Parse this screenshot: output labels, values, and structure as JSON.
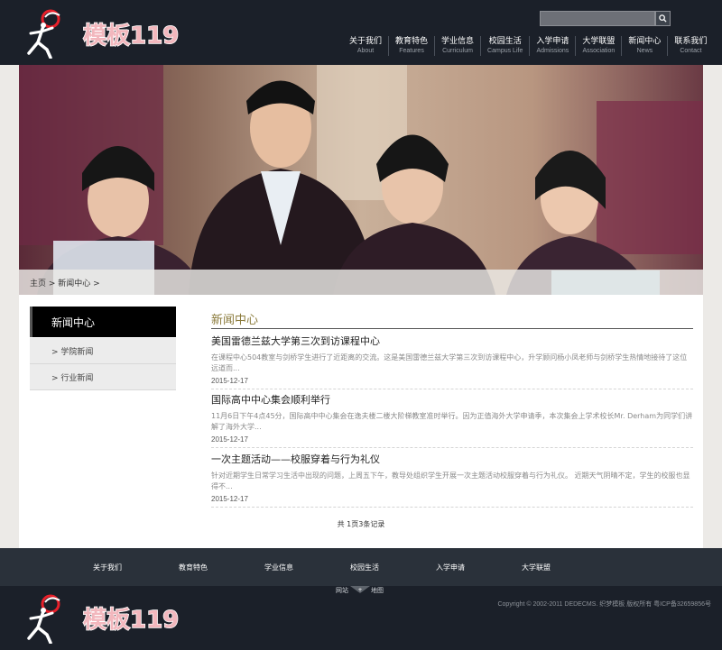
{
  "brand": {
    "logo_text": "模板119",
    "accent_color": "#e8202a",
    "logo_text_color": "#f2b7bd"
  },
  "search": {
    "placeholder": "",
    "button_icon": "search-icon"
  },
  "nav": [
    {
      "zh": "关于我们",
      "en": "About"
    },
    {
      "zh": "教育特色",
      "en": "Features"
    },
    {
      "zh": "学业信息",
      "en": "Curriculum"
    },
    {
      "zh": "校园生活",
      "en": "Campus Life"
    },
    {
      "zh": "入学申请",
      "en": "Admissions"
    },
    {
      "zh": "大学联盟",
      "en": "Association"
    },
    {
      "zh": "新闻中心",
      "en": "News"
    },
    {
      "zh": "联系我们",
      "en": "Contact"
    }
  ],
  "breadcrumb": "主页 > 新闻中心 >",
  "sidebar": {
    "title": "新闻中心",
    "items": [
      "> 学院新闻",
      "> 行业新闻"
    ]
  },
  "section_title": "新闻中心",
  "articles": [
    {
      "title": "美国雷德兰兹大学第三次到访课程中心",
      "summary": "在课程中心504教室与剑桥学生进行了近距离的交流。这是美国雷德兰兹大学第三次到访课程中心，升学顾问杨小凤老师与剑桥学生热情地接待了这位远道而...",
      "date": "2015-12-17"
    },
    {
      "title": "国际高中中心集会顺利举行",
      "summary": "11月6日下午4点45分，国际高中中心集会在逸夫楼二楼大阶梯教室准时举行。因为正值海外大学申请季，本次集会上学术校长Mr. Derham为同学们讲解了海外大学...",
      "date": "2015-12-17"
    },
    {
      "title": "一次主题活动——校服穿着与行为礼仪",
      "summary": "针对近期学生日常学习生活中出现的问题，上周五下午，教导处组织学生开展一次主题活动校服穿着与行为礼仪。 近期天气阴晴不定，学生的校服也显得不...",
      "date": "2015-12-17"
    }
  ],
  "pager": "共 1页3条记录",
  "footer_nav": [
    "关于我们",
    "教育特色",
    "学业信息",
    "校园生活",
    "入学申请",
    "大学联盟"
  ],
  "sitemap": {
    "left": "网站",
    "right": "地图"
  },
  "copyright": "Copyright © 2002-2011 DEDECMS. 织梦模板 版权所有 粤ICP备32659856号"
}
